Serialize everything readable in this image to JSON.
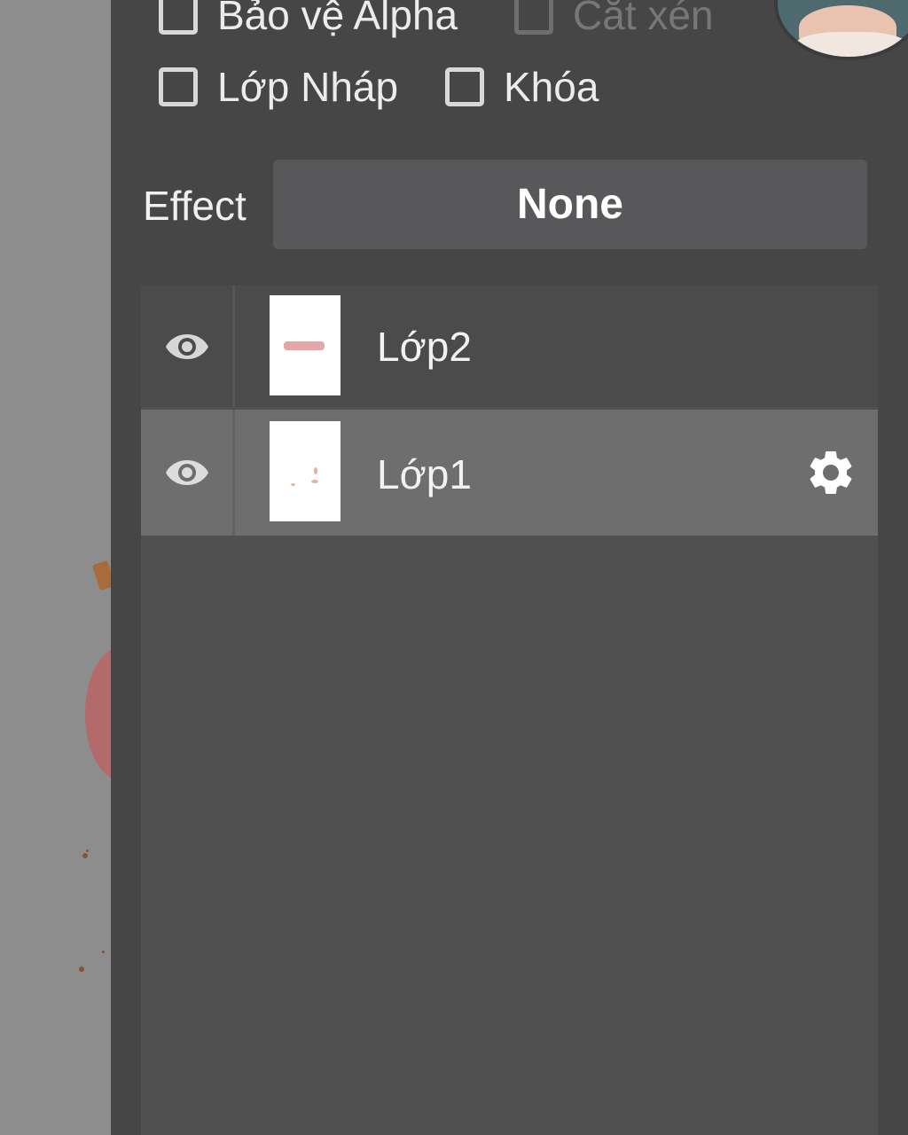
{
  "layer_options": {
    "alpha_protect_label": "Bảo vệ Alpha",
    "clipping_label": "Cắt xén",
    "draft_layer_label": "Lớp Nháp",
    "lock_label": "Khóa"
  },
  "effect": {
    "label": "Effect",
    "value": "None"
  },
  "layers": [
    {
      "name": "Lớp2",
      "visible": true,
      "selected": false
    },
    {
      "name": "Lớp1",
      "visible": true,
      "selected": true
    }
  ],
  "icons": {
    "visibility": "eye-icon",
    "settings": "gear-icon"
  },
  "colors": {
    "panel_bg": "#464646",
    "list_bg": "#505050",
    "selected_row": "#6e6e6e"
  }
}
